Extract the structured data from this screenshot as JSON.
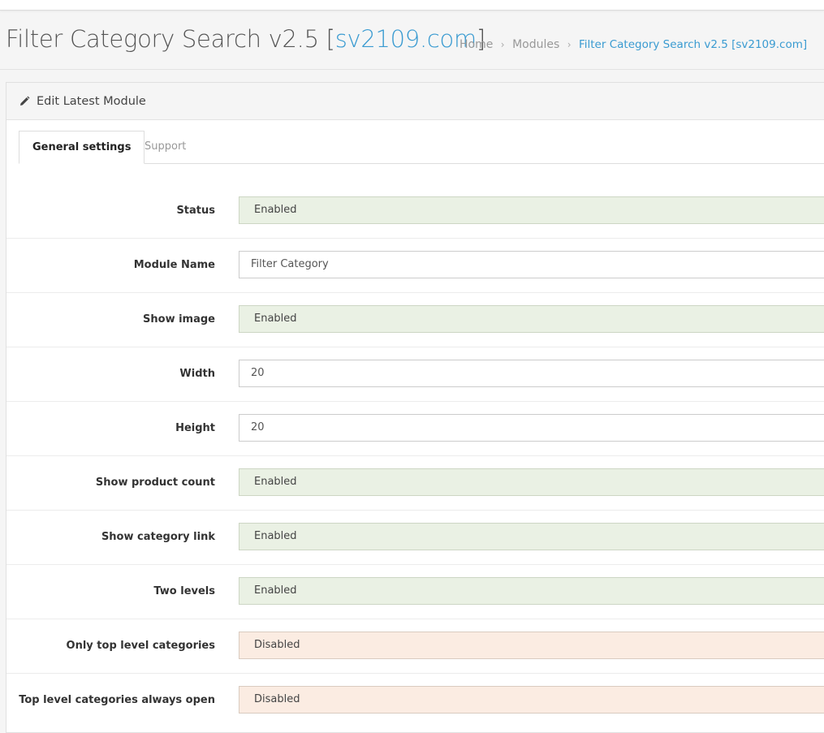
{
  "header": {
    "title_main": "Filter Category Search v2.5 ",
    "title_bracket_open": "[",
    "title_link": "sv2109.com",
    "title_bracket_close": "]"
  },
  "breadcrumb": {
    "items": [
      "Home",
      "Modules",
      "Filter Category Search v2.5 [sv2109.com]"
    ],
    "separator": "›"
  },
  "panel": {
    "title": "Edit Latest Module",
    "icon": "pencil-icon"
  },
  "tabs": [
    "General settings",
    "Support"
  ],
  "fields": [
    {
      "label": "Status",
      "value": "Enabled",
      "kind": "select"
    },
    {
      "label": "Module Name",
      "value": "Filter Category",
      "kind": "text"
    },
    {
      "label": "Show image",
      "value": "Enabled",
      "kind": "select"
    },
    {
      "label": "Width",
      "value": "20",
      "kind": "text"
    },
    {
      "label": "Height",
      "value": "20",
      "kind": "text"
    },
    {
      "label": "Show product count",
      "value": "Enabled",
      "kind": "select"
    },
    {
      "label": "Show category link",
      "value": "Enabled",
      "kind": "select"
    },
    {
      "label": "Two levels",
      "value": "Enabled",
      "kind": "select"
    },
    {
      "label": "Only top level categories",
      "value": "Disabled",
      "kind": "select"
    },
    {
      "label": "Top level categories always open",
      "value": "Disabled",
      "kind": "select"
    }
  ],
  "colors": {
    "link": "#3a9bd1",
    "enabled_bg": "#eaf1e4",
    "disabled_bg": "#fbece2"
  }
}
